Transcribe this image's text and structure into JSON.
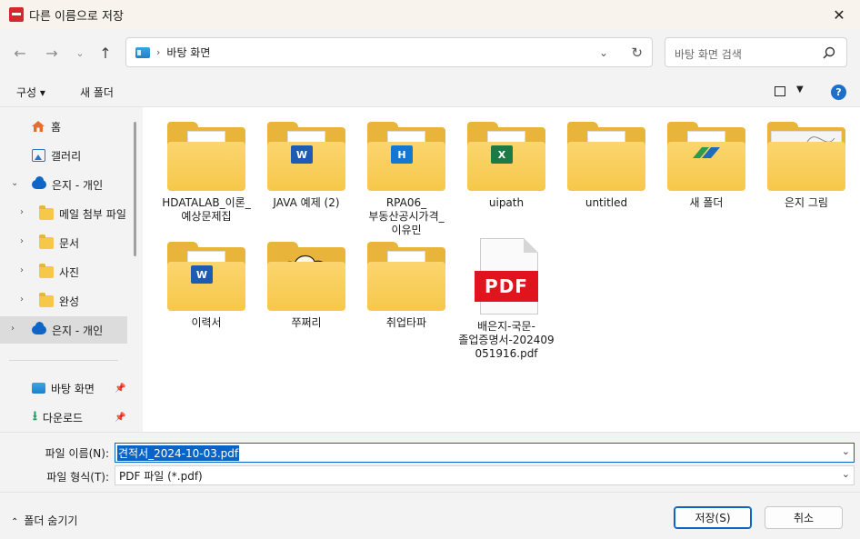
{
  "window": {
    "title": "다른 이름으로 저장",
    "close": "✕"
  },
  "address": {
    "path": [
      "바탕 화면"
    ],
    "search_placeholder": "바탕 화면 검색"
  },
  "toolbar": {
    "organize": "구성 ▾",
    "new_folder": "새 폴더",
    "help": "?"
  },
  "sidebar": {
    "home": "홈",
    "gallery": "갤러리",
    "onedrive_root": "은지 - 개인",
    "folders": [
      "메일 첨부 파일",
      "문서",
      "사진",
      "완성"
    ],
    "onedrive_selected": "은지 - 개인",
    "desktop": "바탕 화면",
    "downloads": "다운로드"
  },
  "files": [
    {
      "label": "HDATALAB_이론_예상문제집",
      "type": "folder",
      "badge": "",
      "badge_color": "#e0141c"
    },
    {
      "label": "JAVA 예제 (2)",
      "type": "folder",
      "badge": "W",
      "badge_color": "#1e5cb3"
    },
    {
      "label": "RPA06_부동산공시가격_이유민",
      "type": "folder",
      "badge": "H",
      "badge_color": "#1477d4"
    },
    {
      "label": "uipath",
      "type": "folder",
      "badge": "X",
      "badge_color": "#1d7a44"
    },
    {
      "label": "untitled",
      "type": "folder",
      "badge": "",
      "badge_color": "#ffffff"
    },
    {
      "label": "새 폴더",
      "type": "folder",
      "badge": "",
      "badge_color": "#2e9a4e"
    },
    {
      "label": "은지 그림",
      "type": "folder",
      "badge": "",
      "badge_color": "#ffffff"
    },
    {
      "label": "이력서",
      "type": "folder",
      "badge": "W",
      "badge_color": "#1e5cb3"
    },
    {
      "label": "쭈쩌리",
      "type": "folder",
      "badge": "",
      "badge_color": "#ffffff"
    },
    {
      "label": "취업타파",
      "type": "folder",
      "badge": "",
      "badge_color": "#ffffff"
    },
    {
      "label": "배은지-국문-졸업증명서-202409051916.pdf",
      "type": "pdf",
      "badge": "PDF",
      "badge_color": "#e0141c"
    }
  ],
  "form": {
    "filename_label": "파일 이름(N):",
    "filename_value": "견적서_2024-10-03.pdf",
    "filetype_label": "파일 형식(T):",
    "filetype_value": "PDF 파일 (*.pdf)"
  },
  "footer": {
    "hide_folders": "폴더 숨기기",
    "save": "저장(S)",
    "cancel": "취소"
  }
}
